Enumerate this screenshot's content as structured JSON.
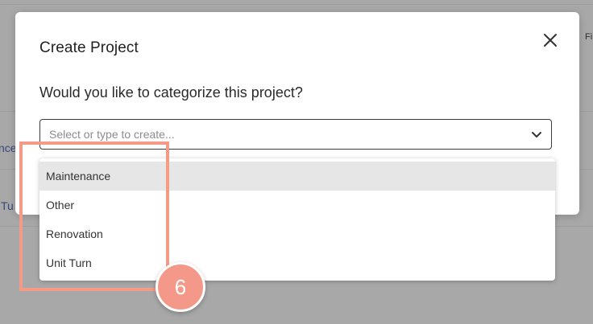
{
  "background": {
    "left_labels": [
      "nce",
      "Tu"
    ],
    "right_label": "Fi"
  },
  "modal": {
    "title": "Create Project",
    "question": "Would you like to categorize this project?",
    "select": {
      "placeholder": "Select or type to create...",
      "value": ""
    },
    "close_icon": "close-icon",
    "chevron_icon": "chevron-down-icon"
  },
  "dropdown": {
    "options": [
      "Maintenance",
      "Other",
      "Renovation",
      "Unit Turn"
    ],
    "highlighted": "Maintenance"
  },
  "tutorial": {
    "step_number": "6",
    "highlight_color": "#f49a86",
    "badge_color": "#f4998a"
  }
}
